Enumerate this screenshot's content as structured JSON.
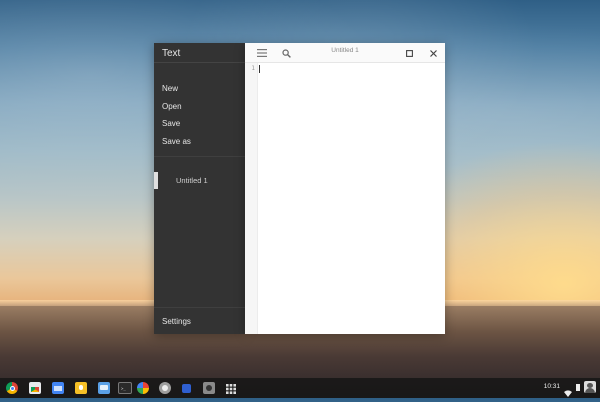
{
  "sidebar": {
    "title": "Text",
    "menu": [
      "New",
      "Open",
      "Save",
      "Save as"
    ],
    "file": "Untitled 1",
    "settings": "Settings"
  },
  "editor": {
    "title": "Untitled 1",
    "line_number": "1"
  },
  "shelf": {
    "apps": [
      "chrome-icon",
      "web-store-icon",
      "files-icon",
      "keep-icon",
      "messages-icon",
      "terminal-icon",
      "photos-icon",
      "camera-app-icon",
      "square-app-icon",
      "camera-icon",
      "app-launcher-icon"
    ],
    "clock": "10:31"
  }
}
